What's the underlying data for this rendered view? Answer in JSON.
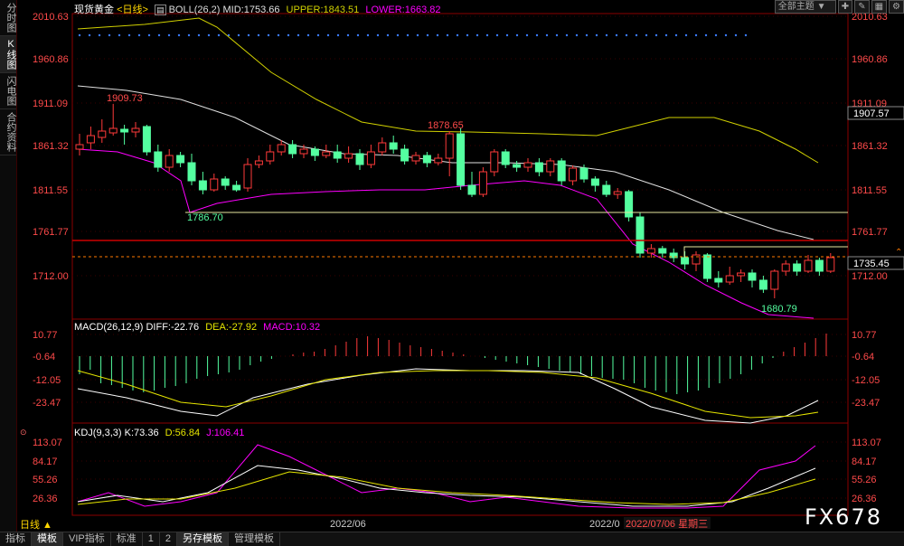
{
  "sidebar": {
    "tabs": [
      {
        "label": "分时图"
      },
      {
        "label": "K线图",
        "active": true
      },
      {
        "label": "闪电图"
      },
      {
        "label": "合约资料"
      }
    ]
  },
  "header": {
    "title": "现货黄金",
    "period_tag": "<日线>",
    "boll": {
      "label": "BOLL(26,2)",
      "mid": "MID:1753.66",
      "upper": "UPPER:1843.51",
      "lower": "LOWER:1663.82"
    }
  },
  "toolbar": {
    "theme_select": "全部主题",
    "dropdown_glyph": "▼"
  },
  "price_axis": {
    "ticks": [
      "2010.63",
      "1960.86",
      "1911.09",
      "1861.32",
      "1811.55",
      "1761.77",
      "1712.00"
    ],
    "current_price": "1735.45",
    "highlight_price": "1907.57"
  },
  "annotations": {
    "high1": "1909.73",
    "high2": "1878.65",
    "low1": "1786.70",
    "low2": "1680.79"
  },
  "macd": {
    "label": "MACD(26,12,9)",
    "diff": "DIFF:-22.76",
    "dea": "DEA:-27.92",
    "macd": "MACD:10.32",
    "ticks": [
      "10.77",
      "-0.64",
      "-12.05",
      "-23.47"
    ]
  },
  "kdj": {
    "label": "KDJ(9,3,3)",
    "k": "K:73.36",
    "d": "D:56.84",
    "j": "J:106.41",
    "ticks": [
      "113.07",
      "84.17",
      "55.26",
      "26.36"
    ]
  },
  "x_axis": {
    "label1": "2022/06",
    "label2": "2022/0",
    "cursor_date": "2022/07/06 星期三"
  },
  "period_button": "日线 ▲",
  "bottom_tabs": [
    {
      "label": "指标"
    },
    {
      "label": "模板",
      "active": true
    },
    {
      "label": "VIP指标"
    },
    {
      "label": "标准"
    },
    {
      "label": "1"
    },
    {
      "label": "2"
    },
    {
      "label": "另存模板",
      "active": true
    },
    {
      "label": "管理模板"
    }
  ],
  "watermark": "FX678",
  "colors": {
    "up": "#ff3a3a",
    "down": "#54ffa0",
    "upper": "#d0d000",
    "mid": "#e0e0e0",
    "lower": "#ff00ff",
    "dea": "#e6e600"
  }
}
